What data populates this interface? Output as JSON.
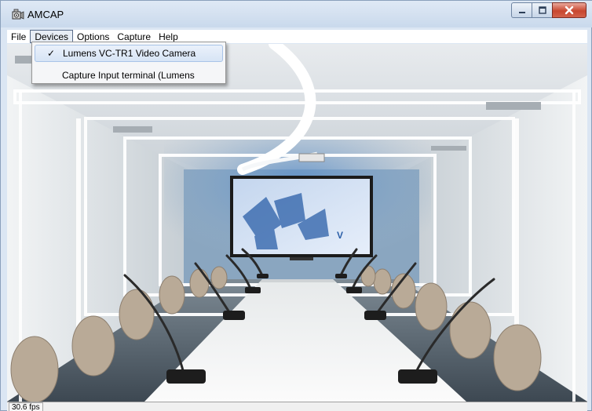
{
  "window": {
    "title": "AMCAP",
    "icon": "webcam-app-icon"
  },
  "menubar": {
    "items": [
      {
        "label": "File"
      },
      {
        "label": "Devices"
      },
      {
        "label": "Options"
      },
      {
        "label": "Capture"
      },
      {
        "label": "Help"
      }
    ]
  },
  "devices_menu": {
    "items": [
      {
        "label": "Lumens VC-TR1 Video Camera",
        "checked": true,
        "check_glyph": "✓"
      },
      {
        "label": "Capture Input terminal (Lumens",
        "checked": false
      }
    ]
  },
  "statusbar": {
    "fps": "30.6 fps"
  },
  "colors": {
    "title_bar": "#c9d9ec",
    "close_button": "#c8472f",
    "menu_highlight": "#d7e4f5"
  }
}
